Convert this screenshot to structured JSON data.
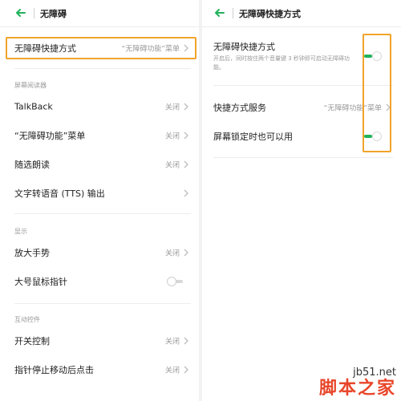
{
  "left": {
    "title": "无障碍",
    "shortcut_row": {
      "label": "无障碍快捷方式",
      "value": "“无障碍功能”菜单"
    },
    "sections": {
      "screen_reader": "屏幕阅读器",
      "display": "显示",
      "interaction": "互动控件"
    },
    "rows": {
      "talkback": {
        "label": "TalkBack",
        "value": "关闭"
      },
      "a11y_menu": {
        "label": "“无障碍功能”菜单",
        "value": "关闭"
      },
      "select_to_speak": {
        "label": "随选朗读",
        "value": "关闭"
      },
      "tts": {
        "label": "文字转语音 (TTS) 输出"
      },
      "magnify": {
        "label": "放大手势",
        "value": "关闭"
      },
      "large_pointer": {
        "label": "大号鼠标指针"
      },
      "switch_access": {
        "label": "开关控制",
        "value": "关闭"
      },
      "dwell_click": {
        "label": "指针停止移动后点击",
        "value": "关闭"
      }
    }
  },
  "right": {
    "title": "无障碍快捷方式",
    "shortcut_toggle": {
      "label": "无障碍快捷方式",
      "desc": "开启后，同时按住两个音量键 3 秒钟即可启动无障碍功能。"
    },
    "service_row": {
      "label": "快捷方式服务",
      "value": "“无障碍功能”菜单"
    },
    "lockscreen_row": {
      "label": "屏幕锁定时也可以用"
    }
  },
  "watermark": {
    "site": "jb51.net",
    "cn": "脚本之家"
  },
  "colors": {
    "accent": "#20b35a",
    "highlight": "#f1a32b",
    "watermark": "#e8462a"
  }
}
